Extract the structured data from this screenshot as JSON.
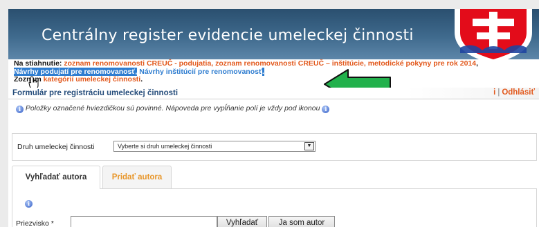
{
  "header": {
    "title": "Centrálny register evidencie umeleckej činnosti",
    "emblem": "slovak-coat-of-arms-icon"
  },
  "downloads": {
    "label": "Na stiahnutie:",
    "link1": "zoznam renomovanosti CREUČ - podujatia",
    "link2": "zoznam renomovanosti CREUČ – inštitúcie",
    "link3": "metodické pokyny pre rok 2014",
    "link4": "Návrhy podujatí pre renomovanosť",
    "link5": "Návrhy inštitúcií pre renomovanosť",
    "categories_label": "Zoznam",
    "categories_link": "kategórií umeleckej činnosti"
  },
  "formbar": {
    "title": "Formulár pre registráciu umeleckej činnosti",
    "left_fragment": "i",
    "separator": "|",
    "logout": "Odhlásiť"
  },
  "info": {
    "text": "Položky označené hviezdičkou sú povinné. Nápoveda pre vypĺňanie polí je vždy pod ikonou"
  },
  "activity": {
    "label": "Druh umeleckej činnosti",
    "selected": "Vyberte si druh umeleckej činnosti"
  },
  "tabs": [
    {
      "label": "Vyhľadať autora"
    },
    {
      "label": "Pridať autora"
    }
  ],
  "search": {
    "surname_label": "Priezvisko *",
    "surname_value": "",
    "search_button": "Vyhľadať",
    "self_button": "Ja som autor"
  },
  "colors": {
    "banner": "#3f6a8d",
    "link_orange": "#e2591d",
    "link_blue": "#2f7dd0",
    "form_title": "#274e7c",
    "tab_orange": "#e8962a",
    "arrow_green": "#22b14c"
  }
}
